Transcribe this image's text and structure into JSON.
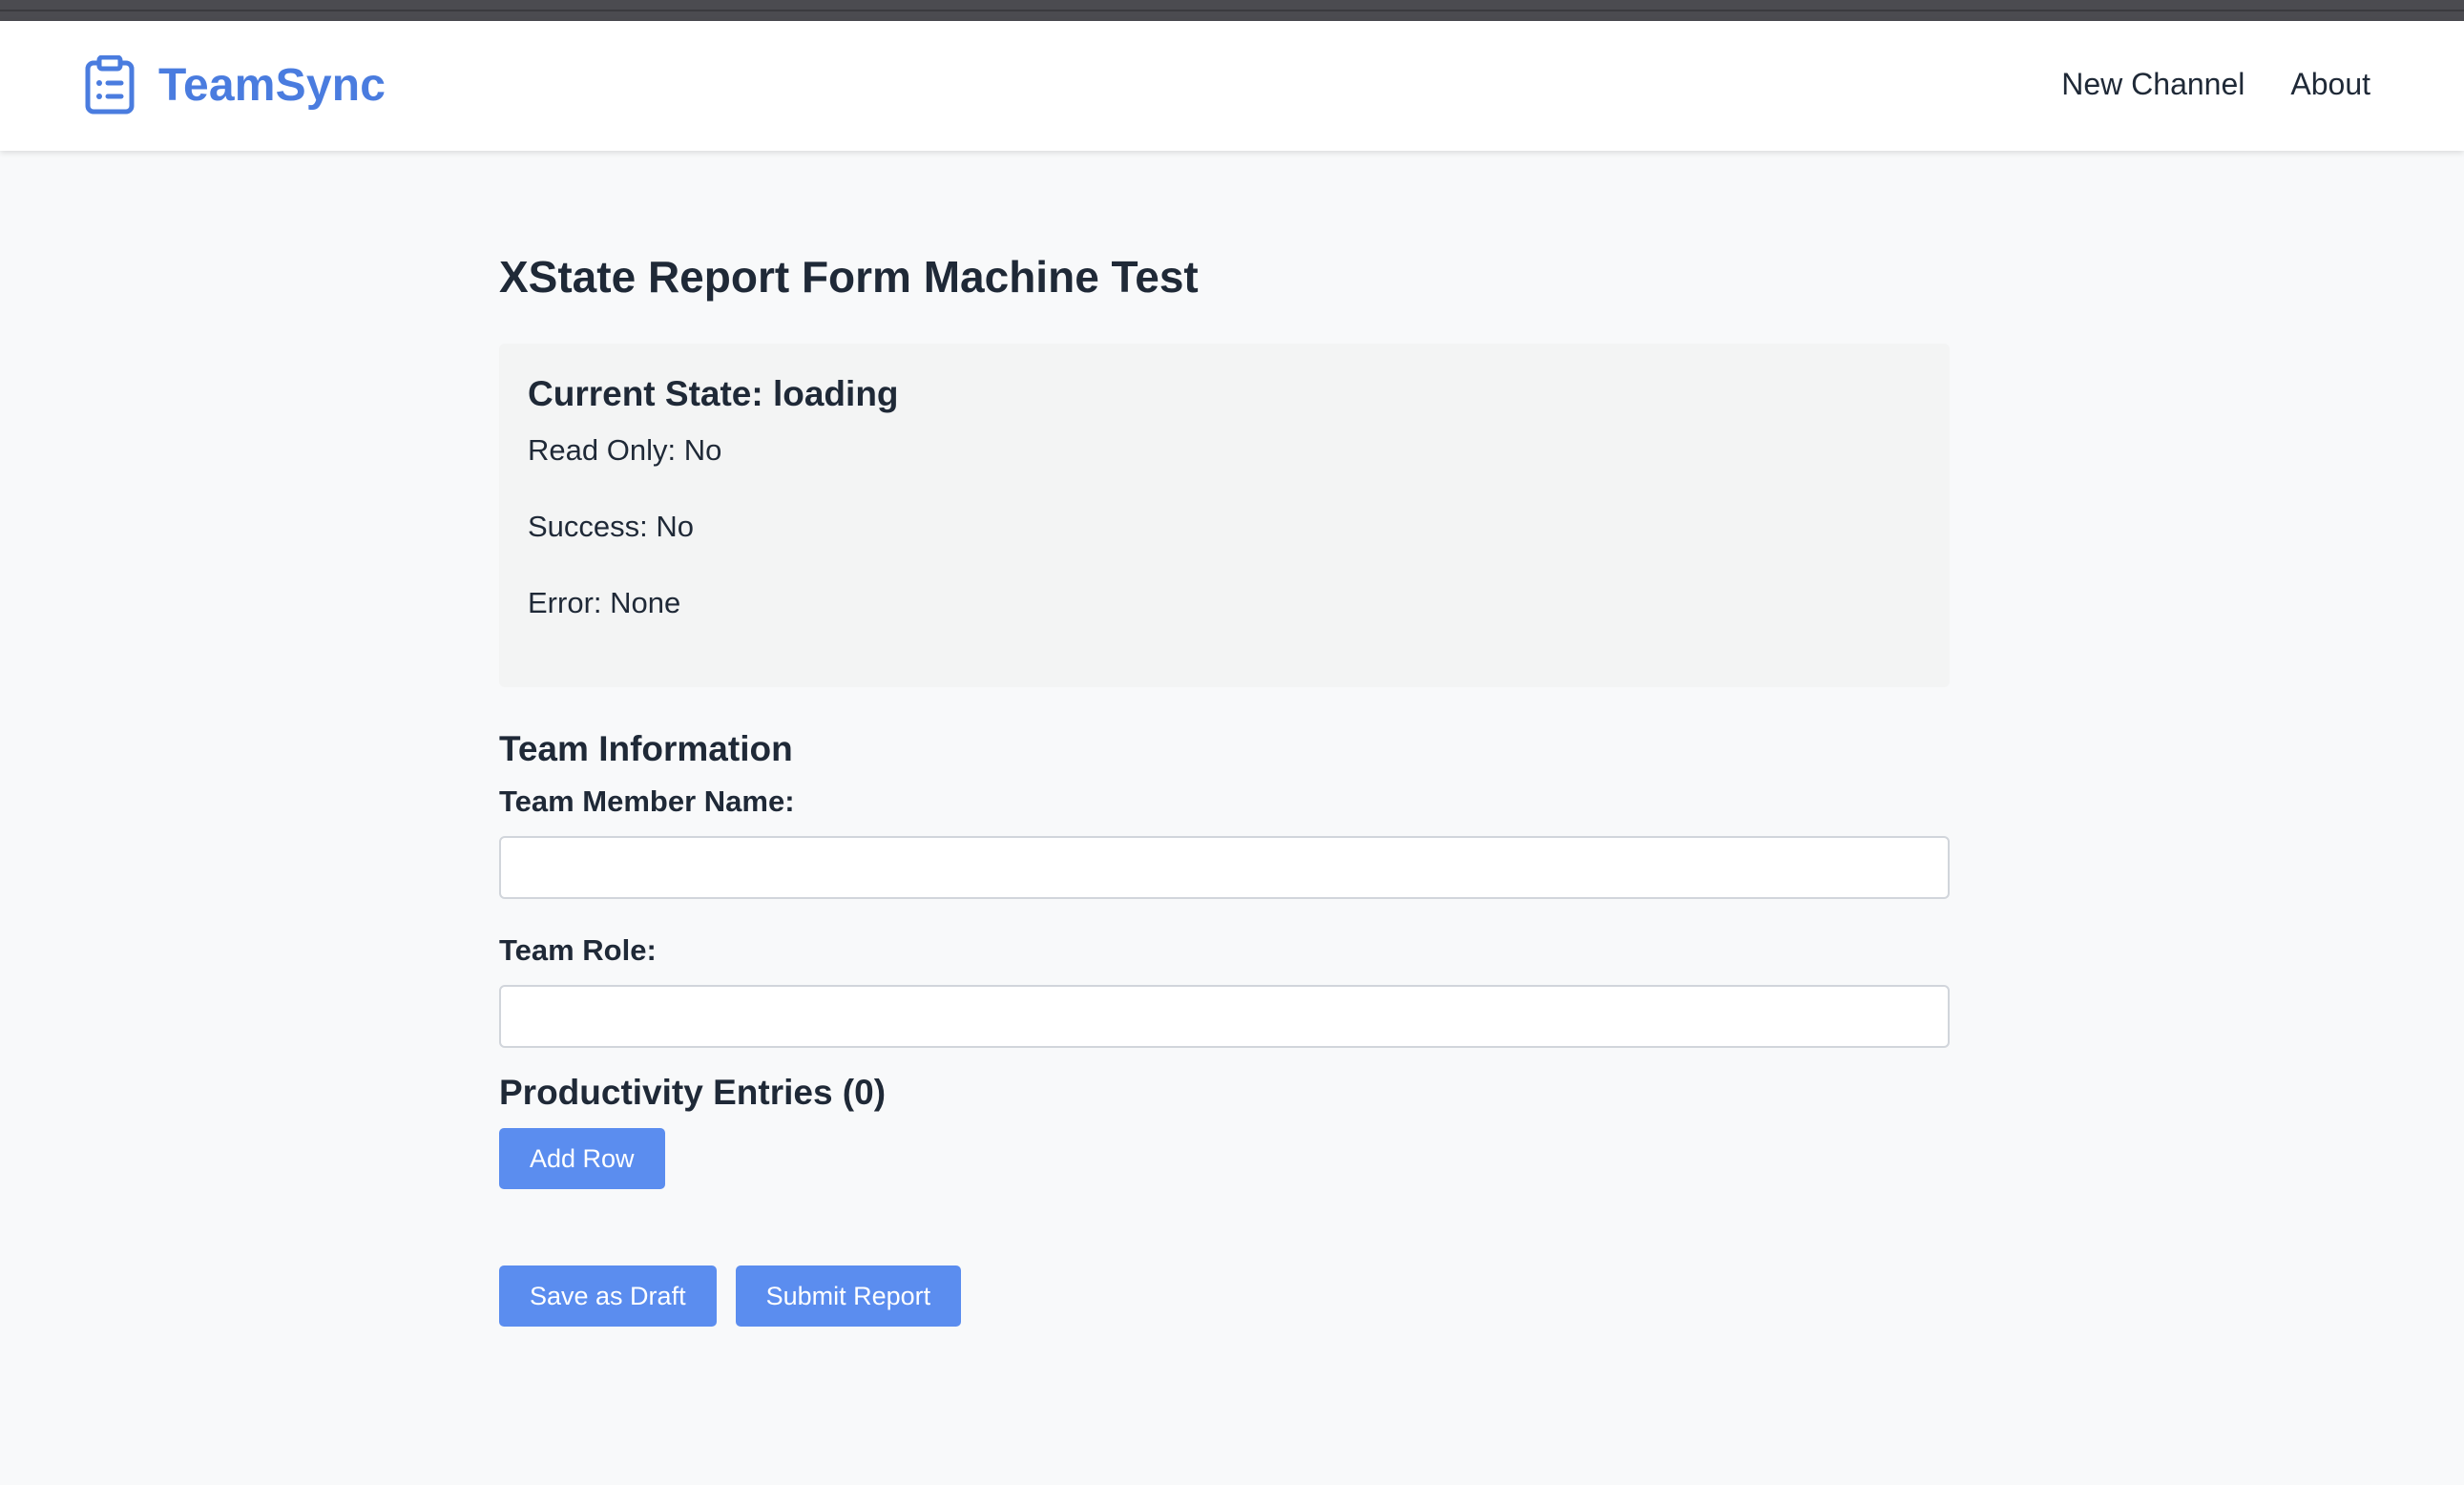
{
  "app": {
    "brand_name": "TeamSync",
    "brand_icon": "clipboard-list-icon",
    "accent_color": "#4a7cdf",
    "button_color": "#5b8def"
  },
  "nav": {
    "links": [
      {
        "label": "New Channel"
      },
      {
        "label": "About"
      }
    ]
  },
  "page": {
    "title": "XState Report Form Machine Test"
  },
  "state_panel": {
    "title": "Current State: loading",
    "read_only": "Read Only: No",
    "success": "Success: No",
    "error": "Error: None"
  },
  "team_info": {
    "section_title": "Team Information",
    "member_name_label": "Team Member Name:",
    "member_name_value": "",
    "role_label": "Team Role:",
    "role_value": ""
  },
  "productivity": {
    "section_title": "Productivity Entries (0)",
    "add_row_label": "Add Row"
  },
  "actions": {
    "save_draft_label": "Save as Draft",
    "submit_label": "Submit Report"
  }
}
